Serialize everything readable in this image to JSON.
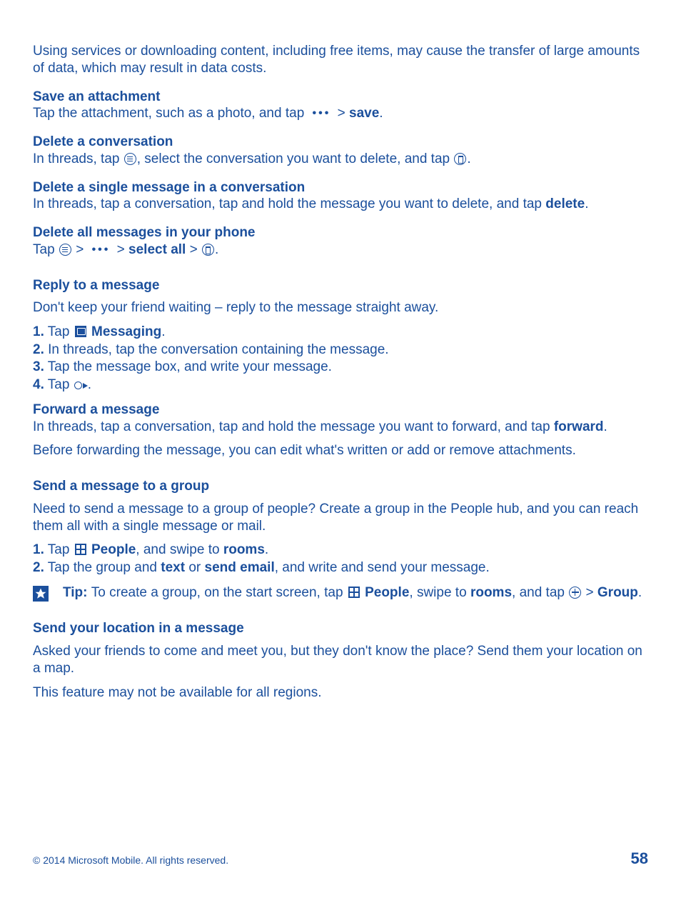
{
  "intro": "Using services or downloading content, including free items, may cause the transfer of large amounts of data, which may result in data costs.",
  "saveAttachment": {
    "heading": "Save an attachment",
    "pre": "Tap the attachment, such as a photo, and tap ",
    "gt": " > ",
    "save": "save",
    "post": "."
  },
  "deleteConversation": {
    "heading": "Delete a conversation",
    "p1": "In threads, tap ",
    "p2": ", select the conversation you want to delete, and tap ",
    "p3": "."
  },
  "deleteSingle": {
    "heading": "Delete a single message in a conversation",
    "pre": "In threads, tap a conversation, tap and hold the message you want to delete, and tap ",
    "delete": "delete",
    "post": "."
  },
  "deleteAll": {
    "heading": "Delete all messages in your phone",
    "tap": "Tap ",
    "gt1": " > ",
    "gt2": " > ",
    "selectAll": "select all",
    "gt3": " > ",
    "post": "."
  },
  "reply": {
    "heading": "Reply to a message",
    "intro": "Don't keep your friend waiting – reply to the message straight away.",
    "steps": {
      "n1": "1.",
      "s1a": " Tap ",
      "s1b": " Messaging",
      "s1c": ".",
      "n2": "2.",
      "s2": " In threads, tap the conversation containing the message.",
      "n3": "3.",
      "s3": " Tap the message box, and write your message.",
      "n4": "4.",
      "s4a": " Tap ",
      "s4b": "."
    }
  },
  "forward": {
    "heading": "Forward a message",
    "p1a": "In threads, tap a conversation, tap and hold the message you want to forward, and tap ",
    "p1b": "forward",
    "p1c": ".",
    "p2": "Before forwarding the message, you can edit what's written or add or remove attachments."
  },
  "group": {
    "heading": "Send a message to a group",
    "intro": "Need to send a message to a group of people? Create a group in the People hub, and you can reach them all with a single message or mail.",
    "steps": {
      "n1": "1.",
      "s1a": " Tap ",
      "s1b": " People",
      "s1c": ", and swipe to ",
      "s1d": "rooms",
      "s1e": ".",
      "n2": "2.",
      "s2a": " Tap the group and ",
      "s2b": "text",
      "s2c": " or ",
      "s2d": "send email",
      "s2e": ", and write and send your message."
    },
    "tip": {
      "label": "Tip: ",
      "a": "To create a group, on the start screen, tap ",
      "people": " People",
      "b": ", swipe to ",
      "rooms": "rooms",
      "c": ", and tap ",
      "gt": " > ",
      "group": "Group",
      "d": "."
    }
  },
  "location": {
    "heading": "Send your location in a message",
    "p1": "Asked your friends to come and meet you, but they don't know the place? Send them your location on a map.",
    "p2": "This feature may not be available for all regions."
  },
  "footer": {
    "copyright": "© 2014 Microsoft Mobile. All rights reserved.",
    "page": "58"
  }
}
